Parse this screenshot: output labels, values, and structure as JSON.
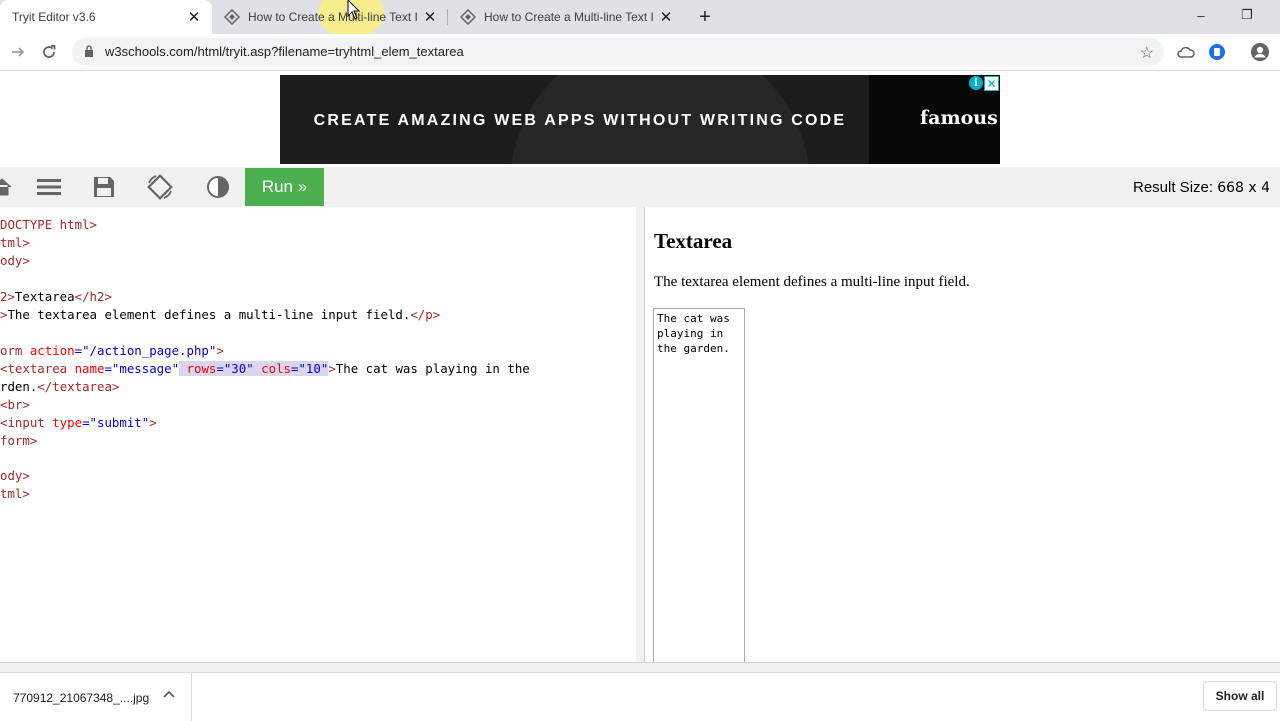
{
  "browser": {
    "tabs": [
      {
        "title": "Tryit Editor v3.6",
        "active": true
      },
      {
        "title": "How to Create a Multi-line Text I",
        "active": false
      },
      {
        "title": "How to Create a Multi-line Text I",
        "active": false
      }
    ],
    "url": "w3schools.com/html/tryit.asp?filename=tryhtml_elem_textarea",
    "window_buttons": {
      "minimize": "–",
      "restore": "❐"
    }
  },
  "ad": {
    "headline": "CREATE AMAZING WEB APPS WITHOUT WRITING CODE",
    "brand": "famous",
    "info_glyph": "i",
    "close_glyph": "✕"
  },
  "editor": {
    "run_label": "Run »",
    "result_size_label": "Result Size: ",
    "result_size_value": "668 x 4"
  },
  "code": {
    "l1": "DOCTYPE html>",
    "l2": "tml>",
    "l3": "ody>",
    "l5a": "2>",
    "l5b": "Textarea",
    "l5c": "</h2>",
    "l6a": ">",
    "l6b": "The textarea element defines a multi-line input field.",
    "l6c": "</p>",
    "l8a": "orm",
    "l8b": " action",
    "l8c": "=\"/action_page.php\"",
    "l8d": ">",
    "l9a": "<textarea",
    "l9b": " name",
    "l9c": "=\"message\"",
    "l9d": " rows",
    "l9e": "=\"30\"",
    "l9f": " cols",
    "l9g": "=\"10\"",
    "l9h": ">",
    "l9i": "The cat was playing in the",
    "l10a": "rden.",
    "l10b": "</textarea>",
    "l11": "<br>",
    "l12a": "<input",
    "l12b": " type",
    "l12c": "=\"submit\"",
    "l12d": ">",
    "l13": "form>",
    "l15": "ody>",
    "l16": "tml>"
  },
  "result": {
    "heading": "Textarea",
    "paragraph": "The textarea element defines a multi-line input field.",
    "textarea_value": "The cat was playing in the garden."
  },
  "downloads": {
    "file_name": "770912_21067348_....jpg",
    "show_all_label": "Show all"
  },
  "colors": {
    "run_button": "#4caf50",
    "tag": "#a52a2a",
    "attribute": "#ff0000",
    "attribute_value": "#0000cd"
  }
}
